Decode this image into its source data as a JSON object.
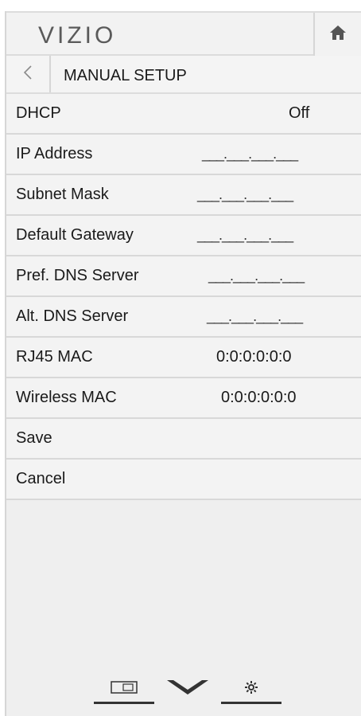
{
  "header": {
    "logo_text": "VIZIO",
    "home_icon": "home-icon"
  },
  "subheader": {
    "back_icon": "back-arrow-icon",
    "title": "MANUAL SETUP"
  },
  "rows": [
    {
      "label": "DHCP",
      "value": "Off"
    },
    {
      "label": "IP Address",
      "value": "___.___.___.___"
    },
    {
      "label": "Subnet Mask",
      "value": "___.___.___.___"
    },
    {
      "label": "Default Gateway",
      "value": "___.___.___.___"
    },
    {
      "label": "Pref. DNS Server",
      "value": "___.___.___.___"
    },
    {
      "label": "Alt. DNS Server",
      "value": "___.___.___.___"
    },
    {
      "label": "RJ45 MAC",
      "value": "0:0:0:0:0:0"
    },
    {
      "label": "Wireless MAC",
      "value": "0:0:0:0:0:0"
    },
    {
      "label": "Save",
      "value": ""
    },
    {
      "label": "Cancel",
      "value": ""
    }
  ],
  "bottom_nav": {
    "input_icon": "input-icon",
    "menu_icon": "chevron-down-icon",
    "settings_icon": "gear-icon"
  },
  "colors": {
    "panel_bg": "#efefef",
    "divider": "#d8d8d8",
    "text": "#1a1a1a",
    "logo": "#5a5a5a"
  }
}
